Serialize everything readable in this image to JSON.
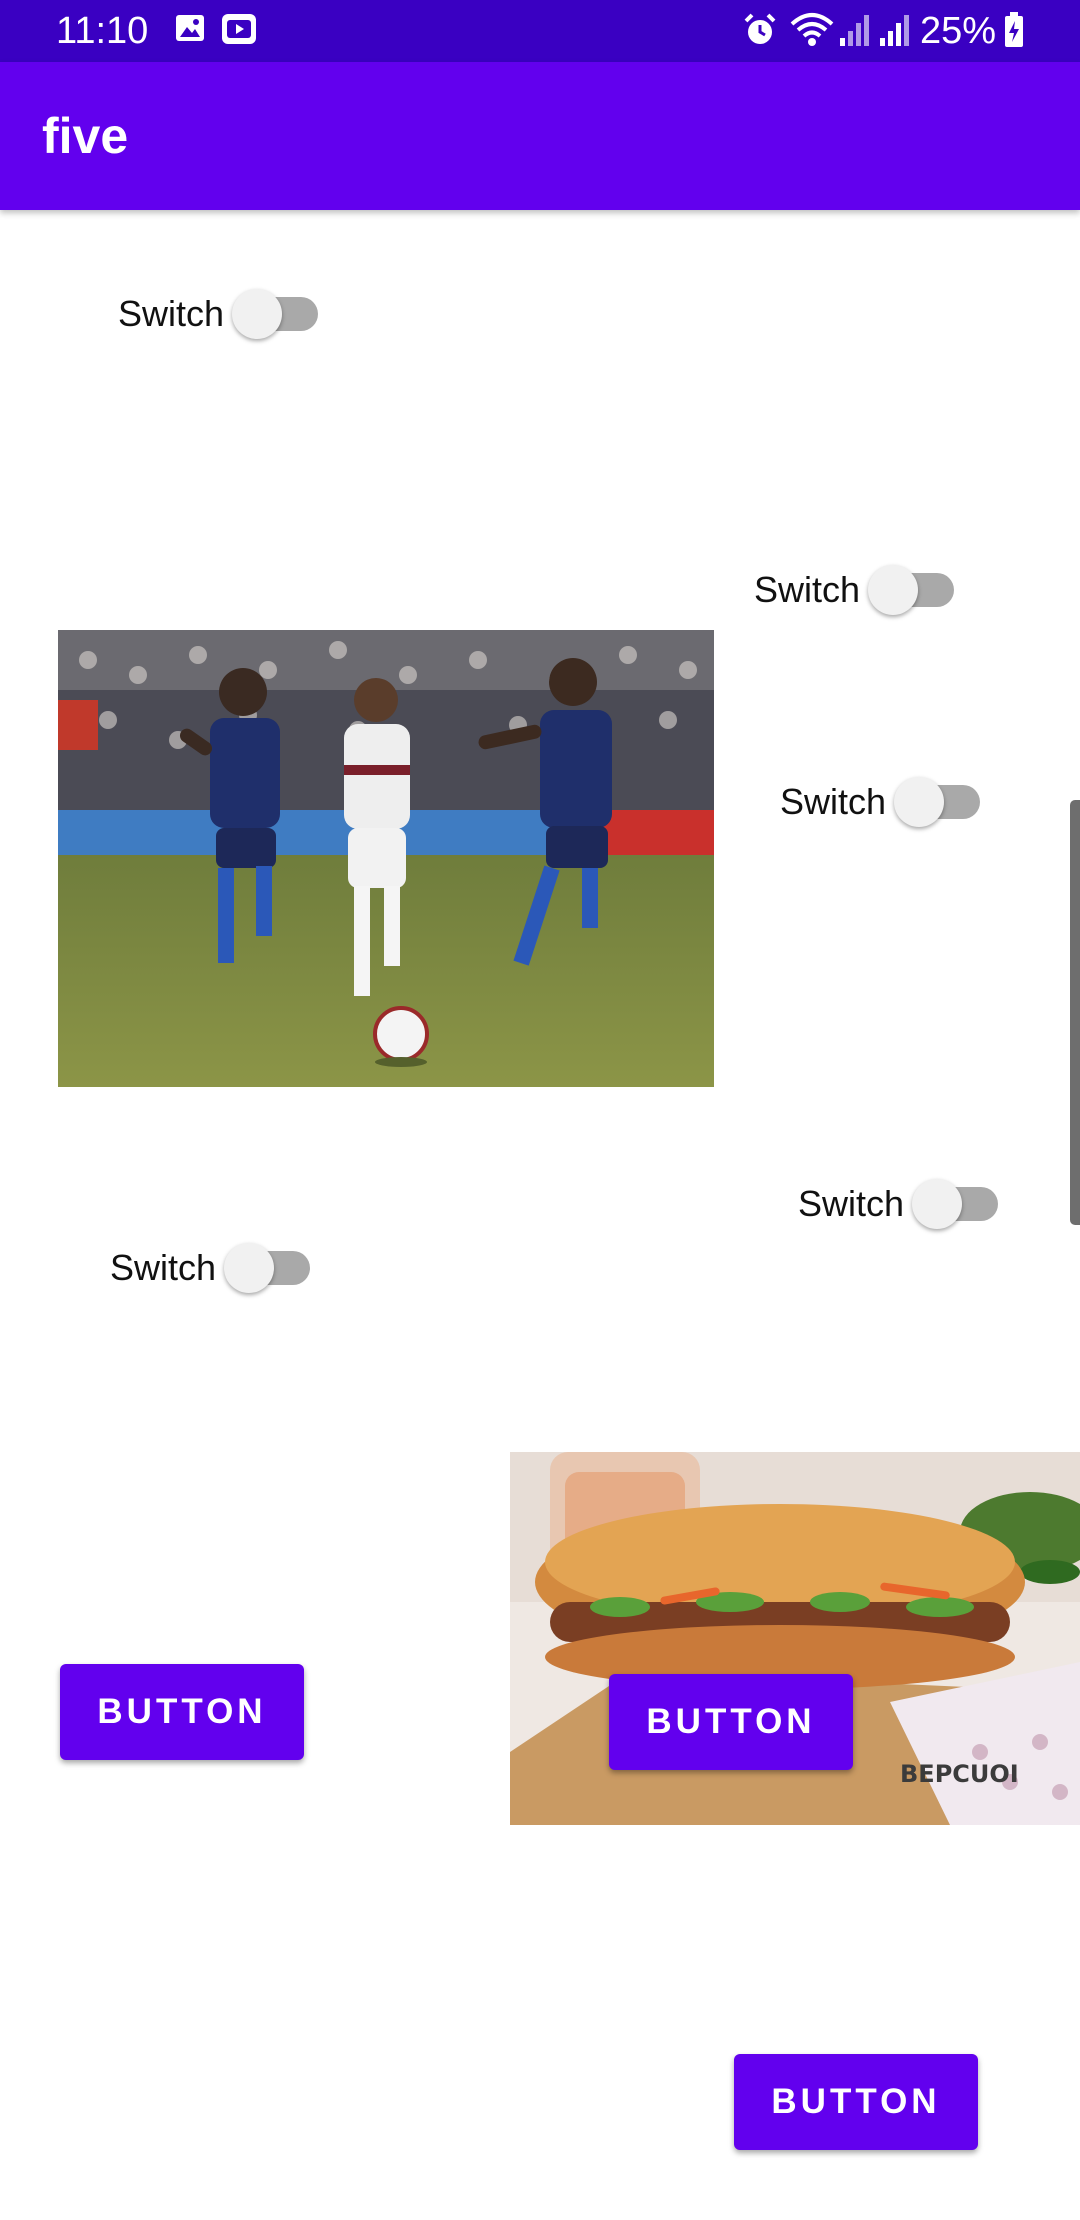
{
  "status_bar": {
    "time": "11:10",
    "battery": "25%",
    "icons": [
      "gallery-icon",
      "video-icon",
      "alarm-icon",
      "wifi-icon",
      "signal-icon",
      "signal-icon",
      "battery-charging-icon"
    ]
  },
  "app_bar": {
    "title": "five"
  },
  "switches": [
    {
      "label": "Switch",
      "checked": false
    },
    {
      "label": "Switch",
      "checked": false
    },
    {
      "label": "Switch",
      "checked": false
    },
    {
      "label": "Switch",
      "checked": false
    },
    {
      "label": "Switch",
      "checked": false
    }
  ],
  "images": {
    "soccer": {
      "subject": "soccer players chasing a ball on a pitch"
    },
    "sandwich": {
      "subject": "banh mi sandwich on wooden board",
      "watermark": "BEPCUOI"
    }
  },
  "buttons": [
    {
      "label": "BUTTON"
    },
    {
      "label": "BUTTON"
    },
    {
      "label": "BUTTON"
    }
  ],
  "colors": {
    "status_bar": "#3a00c2",
    "app_bar": "#6200ee",
    "button": "#6200ee"
  }
}
